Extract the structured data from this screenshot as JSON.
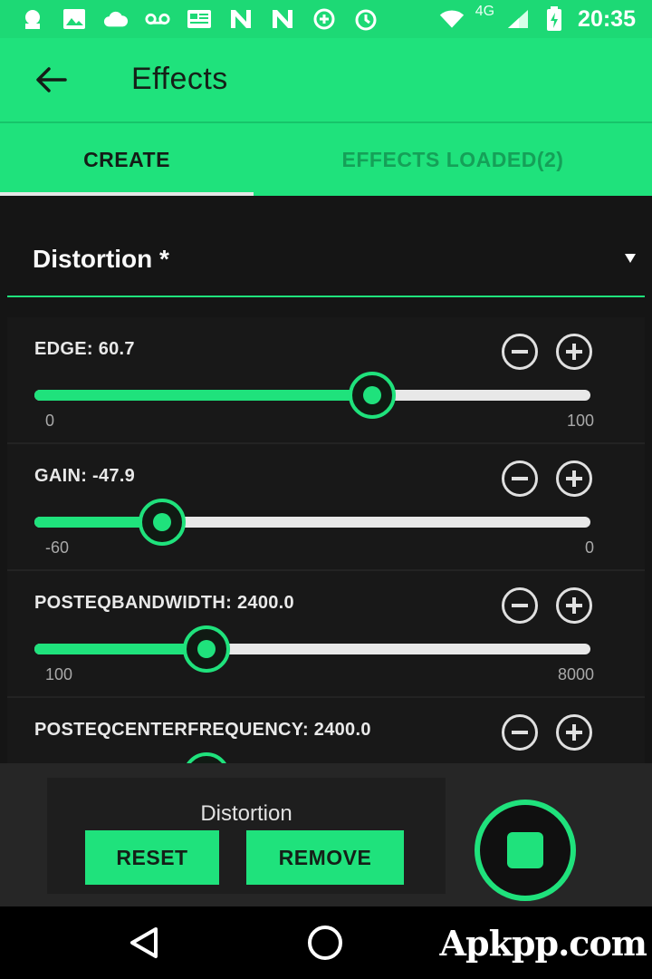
{
  "status_bar": {
    "time": "20:35",
    "network": "4G"
  },
  "app_bar": {
    "title": "Effects"
  },
  "tabs": [
    {
      "label": "CREATE",
      "selected": true
    },
    {
      "label": "EFFECTS LOADED(2)",
      "selected": false
    }
  ],
  "effect_selector": {
    "value": "Distortion *"
  },
  "params": [
    {
      "label": "EDGE: 60.7",
      "min": "0",
      "max": "100",
      "fraction": 0.607
    },
    {
      "label": "GAIN: -47.9",
      "min": "-60",
      "max": "0",
      "fraction": 0.23
    },
    {
      "label": "POSTEQBANDWIDTH: 2400.0",
      "min": "100",
      "max": "8000",
      "fraction": 0.31
    },
    {
      "label": "POSTEQCENTERFREQUENCY: 2400.0",
      "min": "",
      "max": "",
      "fraction": 0.31
    }
  ],
  "bottom_panel": {
    "current_effect": "Distortion",
    "reset_label": "RESET",
    "remove_label": "REMOVE"
  },
  "watermark": "Apkpp.com",
  "colors": {
    "accent": "#1fe27c",
    "background": "#151515"
  }
}
